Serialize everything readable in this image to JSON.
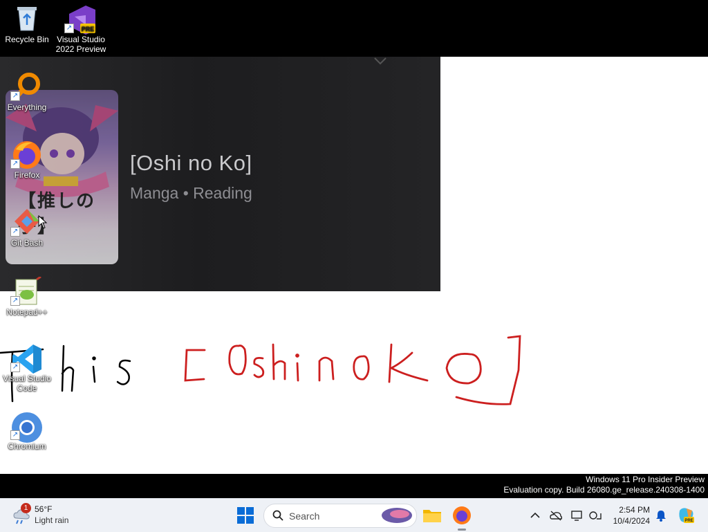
{
  "desktop": {
    "icons": [
      {
        "label": "Recycle Bin"
      },
      {
        "label": "Visual Studio 2022 Preview",
        "badge": "PRE"
      },
      {
        "label": "Everything"
      },
      {
        "label": "Firefox"
      },
      {
        "label": "Git Bash"
      },
      {
        "label": "Notepad++"
      },
      {
        "label": "Visual Studio Code"
      },
      {
        "label": "Chromium"
      }
    ]
  },
  "pasted_image": {
    "title": "[Oshi no Ko]",
    "subtitle": "Manga • Reading",
    "cover_text": "【推しの子】"
  },
  "handwriting": {
    "black_text": "This",
    "red_text": "[OshinoKO]",
    "black_color": "#000000",
    "red_color": "#cc1f1f"
  },
  "watermark": {
    "line1": "Windows 11 Pro Insider Preview",
    "line2": "Evaluation copy. Build 26080.ge_release.240308-1400"
  },
  "taskbar": {
    "weather": {
      "temp": "56°F",
      "desc": "Light rain",
      "badge_count": "1"
    },
    "search_placeholder": "Search",
    "clock": {
      "time": "2:54 PM",
      "date": "10/4/2024"
    },
    "copilot_badge": "PRE"
  },
  "colors": {
    "taskbar_bg": "#eef1f6",
    "canvas_bg": "#ffffff",
    "accent": "#0067c0"
  }
}
